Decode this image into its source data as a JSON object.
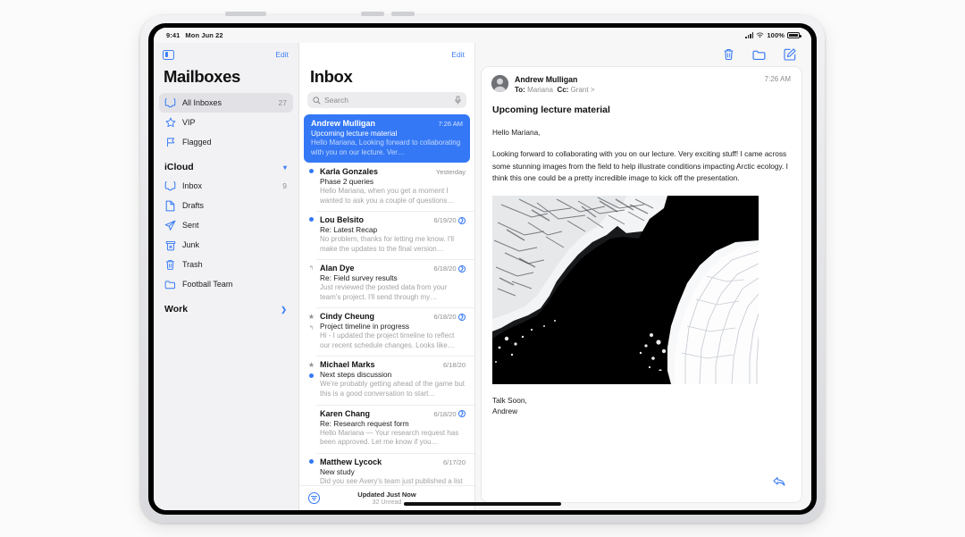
{
  "status_bar": {
    "time": "9:41",
    "date": "Mon Jun 22",
    "battery_pct": "100%"
  },
  "sidebar": {
    "edit_label": "Edit",
    "title": "Mailboxes",
    "items": [
      {
        "label": "All Inboxes",
        "count": "27",
        "icon": "inbox-icon",
        "selected": true
      },
      {
        "label": "VIP",
        "count": "",
        "icon": "star-icon",
        "selected": false
      },
      {
        "label": "Flagged",
        "count": "",
        "icon": "flag-icon",
        "selected": false
      }
    ],
    "groups": [
      {
        "name": "iCloud",
        "chevron": "down",
        "items": [
          {
            "label": "Inbox",
            "count": "9",
            "icon": "inbox-icon"
          },
          {
            "label": "Drafts",
            "count": "",
            "icon": "document-icon"
          },
          {
            "label": "Sent",
            "count": "",
            "icon": "paperplane-icon"
          },
          {
            "label": "Junk",
            "count": "",
            "icon": "junk-bin-icon"
          },
          {
            "label": "Trash",
            "count": "",
            "icon": "trash-icon"
          },
          {
            "label": "Football Team",
            "count": "",
            "icon": "folder-icon"
          }
        ]
      },
      {
        "name": "Work",
        "chevron": "right",
        "items": []
      }
    ]
  },
  "list_pane": {
    "edit_label": "Edit",
    "title": "Inbox",
    "search_placeholder": "Search",
    "messages": [
      {
        "from": "Andrew Mulligan",
        "date": "7:26 AM",
        "subject": "Upcoming lecture material",
        "preview": "Hello Mariana, Looking forward to collaborating with you on our lecture. Ver…",
        "selected": true,
        "unread": false,
        "flagged": false,
        "replied": false,
        "has_chevron": false
      },
      {
        "from": "Karla Gonzales",
        "date": "Yesterday",
        "subject": "Phase 2 queries",
        "preview": "Hello Mariana, when you get a moment I wanted to ask you a couple of questions…",
        "selected": false,
        "unread": true,
        "flagged": false,
        "replied": false,
        "has_chevron": false
      },
      {
        "from": "Lou Belsito",
        "date": "6/19/20",
        "subject": "Re: Latest Recap",
        "preview": "No problem, thanks for letting me know. I'll make the updates to the final version…",
        "selected": false,
        "unread": true,
        "flagged": false,
        "replied": false,
        "has_chevron": true
      },
      {
        "from": "Alan Dye",
        "date": "6/18/20",
        "subject": "Re: Field survey results",
        "preview": "Just reviewed the posted data from your team's project. I'll send through my…",
        "selected": false,
        "unread": false,
        "flagged": false,
        "replied": true,
        "has_chevron": true
      },
      {
        "from": "Cindy Cheung",
        "date": "6/18/20",
        "subject": "Project timeline in progress",
        "preview": "Hi - I updated the project timeline to reflect our recent schedule changes. Looks like…",
        "selected": false,
        "unread": false,
        "flagged": true,
        "replied": true,
        "has_chevron": true
      },
      {
        "from": "Michael Marks",
        "date": "6/18/20",
        "subject": "Next steps discussion",
        "preview": "We're probably getting ahead of the game but this is a good conversation to start…",
        "selected": false,
        "unread": true,
        "flagged": true,
        "replied": false,
        "has_chevron": false
      },
      {
        "from": "Karen Chang",
        "date": "6/18/20",
        "subject": "Re: Research request form",
        "preview": "Hello Mariana — Your research request has been approved. Let me know if you…",
        "selected": false,
        "unread": false,
        "flagged": false,
        "replied": false,
        "has_chevron": true
      },
      {
        "from": "Matthew Lycock",
        "date": "6/17/20",
        "subject": "New study",
        "preview": "Did you see Avery's team just published a list of studies to look at? There's one I had not…",
        "selected": false,
        "unread": true,
        "flagged": false,
        "replied": false,
        "has_chevron": false
      }
    ],
    "footer": {
      "updated": "Updated Just Now",
      "unread": "32 Unread"
    }
  },
  "detail": {
    "toolbar_icons": [
      "trash-icon",
      "folder-icon",
      "compose-icon"
    ],
    "sender": "Andrew Mulligan",
    "to_label": "To:",
    "to_value": "Mariana",
    "cc_label": "Cc:",
    "cc_value": "Grant",
    "recipients_chevron": ">",
    "time": "7:26 AM",
    "subject": "Upcoming lecture material",
    "paragraphs": [
      "Hello Mariana,",
      "Looking forward to collaborating with you on our lecture. Very exciting stuff! I came across some stunning images from the field to help illustrate conditions impacting Arctic ecology. I think this one could be a pretty incredible image to kick off the presentation."
    ],
    "image_alt": "Aerial photograph of Arctic glacier ice and dark open water",
    "signature": [
      "Talk Soon,",
      "Andrew"
    ],
    "reply_icon": "reply-arrow-icon"
  },
  "colors": {
    "accent": "#3478f6",
    "selected_row": "#3478f6",
    "sidebar_bg": "#f2f2f4"
  }
}
